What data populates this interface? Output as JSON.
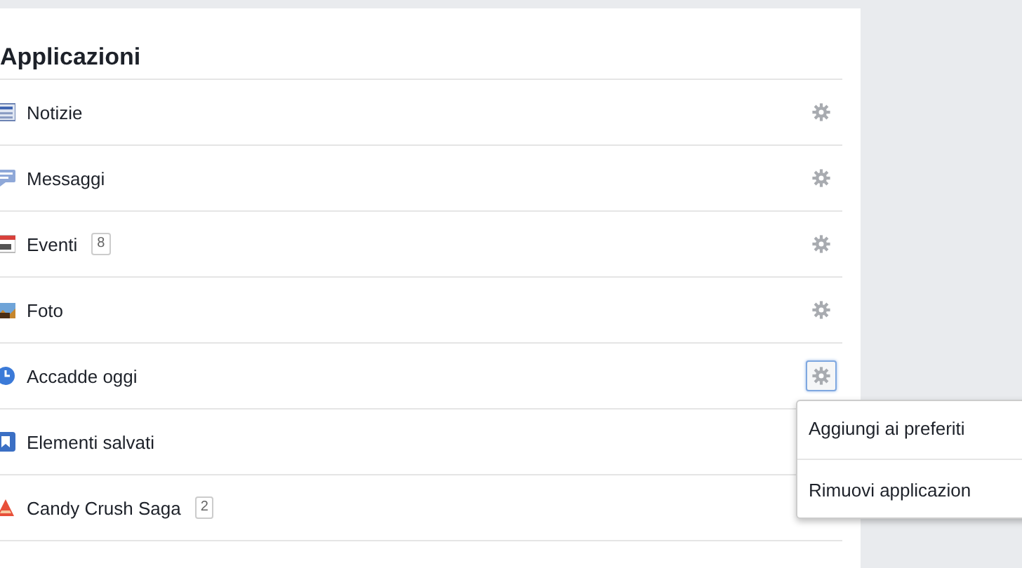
{
  "title": "Applicazioni",
  "apps": [
    {
      "name": "Notizie",
      "kind": "news",
      "menu_open": false
    },
    {
      "name": "Messaggi",
      "kind": "messages",
      "menu_open": false
    },
    {
      "name": "Eventi",
      "kind": "calendar",
      "count": "8",
      "menu_open": false
    },
    {
      "name": "Foto",
      "kind": "photo",
      "menu_open": false
    },
    {
      "name": "Accadde oggi",
      "kind": "memory",
      "menu_open": true
    },
    {
      "name": "Elementi salvati",
      "kind": "bookmark",
      "menu_open": false
    },
    {
      "name": "Candy Crush Saga",
      "kind": "game",
      "count": "2",
      "menu_open": false
    }
  ],
  "menu": [
    "Aggiungi ai preferiti",
    "Rimuovi applicazion"
  ]
}
